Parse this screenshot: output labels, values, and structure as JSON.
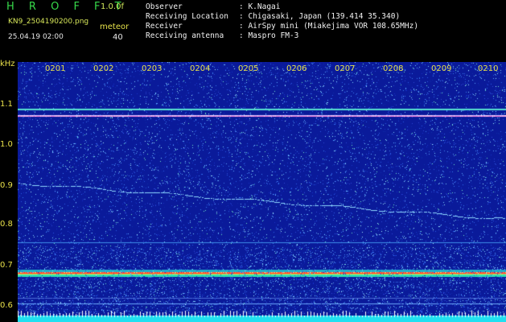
{
  "header": {
    "app_title": "H R O F F T",
    "version": "1.0.0f",
    "filename": "KN9_2504190200.png",
    "mode": "meteor",
    "datetime": "25.04.19 02:00",
    "count": "40"
  },
  "info": [
    {
      "key": "Observer",
      "value": ": K.Nagai"
    },
    {
      "key": "Receiving Location",
      "value": ": Chigasaki, Japan (139.414 35.340)"
    },
    {
      "key": "Receiver",
      "value": ": AirSpy mini (Miakejima VOR 108.65MHz)"
    },
    {
      "key": "Receiving antenna",
      "value": ": Maspro FM-3"
    }
  ],
  "spectrogram": {
    "y_unit": "kHz",
    "y_ticks": [
      "1.1",
      "1.0",
      "0.9",
      "0.8",
      "0.7",
      "0.6"
    ],
    "x_ticks": [
      "0201",
      "0202",
      "0203",
      "0204",
      "0205",
      "0206",
      "0207",
      "0208",
      "0209",
      "0210"
    ],
    "background_color": "#0a1a9a",
    "accent_color": "#e8e04a"
  }
}
